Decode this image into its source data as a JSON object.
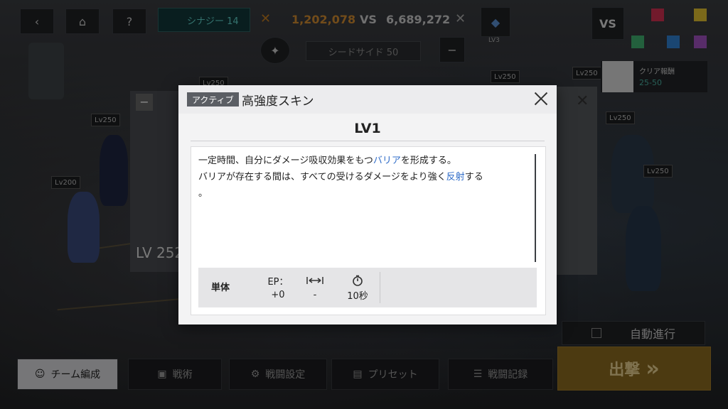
{
  "topbar": {
    "synergy_label": "シナジー 14",
    "score_left": "1,202,078",
    "vs": "VS",
    "score_right": "6,689,272",
    "seed_label": "シードサイド 50",
    "lv3": "LV3"
  },
  "background": {
    "lv_tags": [
      "Lv250",
      "Lv250",
      "Lv250",
      "Lv250",
      "Lv250",
      "Lv200",
      "Lv250"
    ],
    "char_level": "LV 252",
    "clear_label": "クリア報酬",
    "clear_value": "25-50",
    "auto_label": "自動進行"
  },
  "bottombar": {
    "team": "チーム編成",
    "tactics": "戦術",
    "battle_settings": "戦闘設定",
    "preset": "プリセット",
    "battle_log": "戦闘記録",
    "sortie": "出撃"
  },
  "modal": {
    "badge": "アクティブ",
    "skill_name": "高強度スキン",
    "level": "LV1",
    "desc_line1_a": "一定時間、自分にダメージ吸収効果をもつ",
    "desc_line1_hl": "バリア",
    "desc_line1_b": "を形成する。",
    "desc_line2_a": "バリアが存在する間は、すべての受けるダメージをより強く",
    "desc_line2_hl": "反射",
    "desc_line2_b": "する",
    "desc_line3": "。",
    "target": "単体",
    "ep_label": "EP：",
    "ep_value": "+0",
    "range_value": "-",
    "cooldown_value": "10秒"
  },
  "colors": {
    "highlight": "#2f6cc8",
    "sortie": "#c9962a"
  }
}
